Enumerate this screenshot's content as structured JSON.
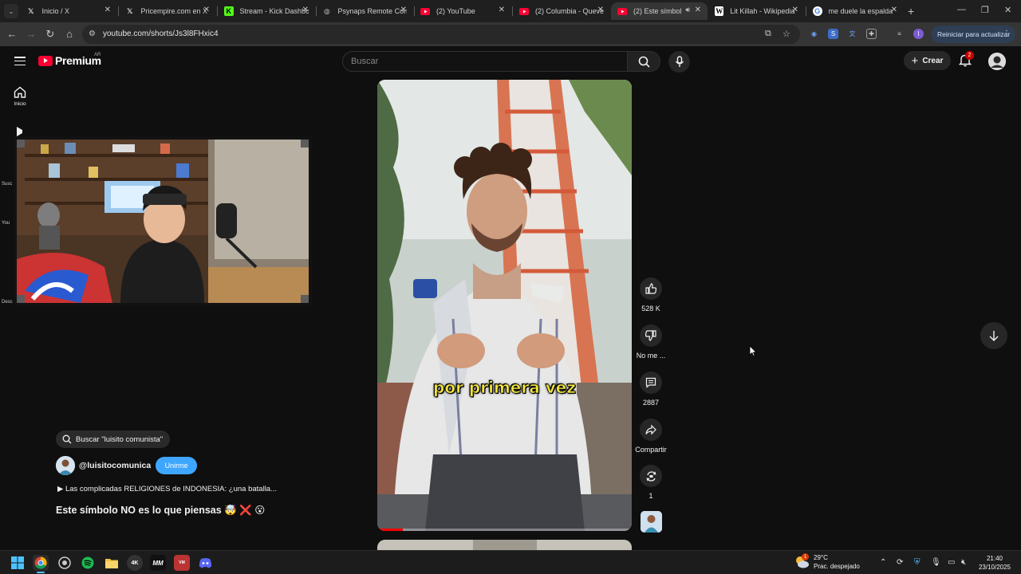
{
  "browser": {
    "tabs": [
      {
        "title": "Inicio / X",
        "favicon": "x-logo-icon",
        "left": 0
      },
      {
        "title": "Pricempire.com en X",
        "favicon": "x-logo-icon"
      },
      {
        "title": "Stream - Kick Dashbo",
        "favicon": "kick-logo-icon"
      },
      {
        "title": "Psynaps Remote Con",
        "favicon": "globe-icon"
      },
      {
        "title": "(2) YouTube",
        "favicon": "youtube-logo-icon"
      },
      {
        "title": "(2) Columbia - Queve",
        "favicon": "youtube-logo-icon"
      },
      {
        "title": "(2) Este símbolo N",
        "favicon": "youtube-logo-icon",
        "active": true
      },
      {
        "title": "Lit Killah - Wikipedia",
        "favicon": "wikipedia-icon"
      },
      {
        "title": "me duele la espalda",
        "favicon": "google-icon"
      }
    ],
    "url": "youtube.com/shorts/Js3l8FHxic4",
    "update_button": "Reiniciar para actualizar"
  },
  "youtube": {
    "logo_text": "Premium",
    "country_code": "AR",
    "search_placeholder": "Buscar",
    "create_label": "Crear",
    "notification_count": "2",
    "guide": {
      "home_label": "Inicio",
      "frag_subs": "Susc",
      "frag_you": "You",
      "frag_desc": "Desc"
    },
    "short": {
      "caption": "por primera vez",
      "progress_fraction": 0.1,
      "likes": "528 K",
      "dislike_label": "No me ...",
      "comments": "2887",
      "share_label": "Compartir",
      "remix_count": "1",
      "search_chip": "Buscar \"luisito comunista\"",
      "channel": "@luisitocomunica",
      "join_label": "Unirme",
      "playlist": "▶  Las complicadas RELIGIONES de INDONESIA: ¿una batalla...",
      "title": "Este símbolo NO es lo que piensas 🤯 ❌ 😮"
    }
  },
  "taskbar": {
    "weather_temp": "29°C",
    "weather_desc": "Prac. despejado",
    "time": "21:40",
    "date": "23/10/2025",
    "weather_badge": "1"
  },
  "colors": {
    "yt_red": "#ff0033",
    "join_blue": "#3ea6ff",
    "caption_yellow": "#f4e63a",
    "badge_red": "#cc0000"
  }
}
